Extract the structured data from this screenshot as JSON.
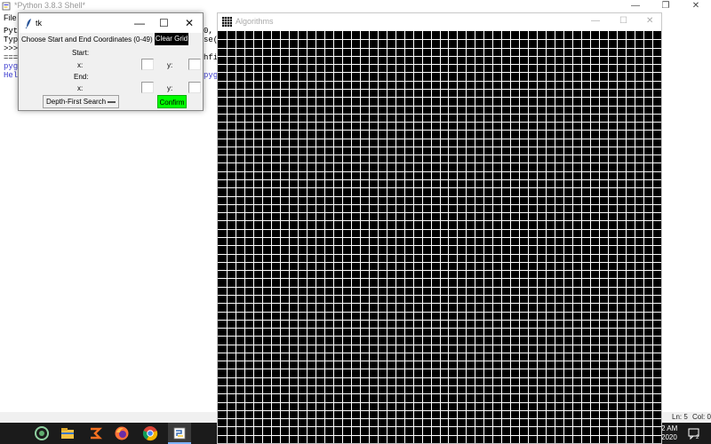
{
  "shell": {
    "title": "*Python 3.8.3 Shell*",
    "controls": [
      "—",
      "❐",
      "✕"
    ],
    "menu": {
      "file": "File"
    },
    "lines": [
      {
        "text": "Pyth",
        "blue": false
      },
      {
        "text": "Type",
        "blue": false
      },
      {
        "text": ">>>",
        "blue": false
      },
      {
        "text": "====",
        "blue": false
      },
      {
        "text": "pyga",
        "blue": true
      },
      {
        "text": "Hell",
        "blue": true
      }
    ],
    "fragments": {
      "f1": "0,",
      "f2": "se(",
      "f3": "hfi",
      "f4": "pyg"
    },
    "status": {
      "ln": "Ln: 5",
      "col": "Col: 0"
    }
  },
  "taskbar": {
    "icons": [
      "windows-logo-icon",
      "search-icon",
      "task-view-icon",
      "wifi-app-icon",
      "file-explorer-icon",
      "app-icon",
      "firefox-icon",
      "chrome-icon",
      "python-idle-icon"
    ],
    "clock_time": "2 AM",
    "clock_date": "2020",
    "notification_count": "2"
  },
  "algo_window": {
    "title": "Algorithms",
    "minimize": "—",
    "maximize": "☐",
    "close": "✕",
    "grid": {
      "cols": 50,
      "rows": 50,
      "cell_color": "#000000",
      "line_color": "#ffffff"
    }
  },
  "tk_dialog": {
    "title": "tk",
    "minimize": "—",
    "maximize": "☐",
    "close": "✕",
    "prompt": "Choose Start and End Coordinates (0-49)",
    "clear_label": "Clear Grid",
    "start_label": "Start:",
    "end_label": "End:",
    "x_label": "x:",
    "y_label": "y:",
    "start_x": "",
    "start_y": "",
    "end_x": "",
    "end_y": "",
    "algorithm": "Depth-First Search",
    "confirm_label": "Confirm"
  },
  "colors": {
    "clear_button_bg": "#000000",
    "confirm_button_bg": "#00ff00",
    "grid_bg": "#000000",
    "taskbar_bg": "#1b1b1b"
  }
}
